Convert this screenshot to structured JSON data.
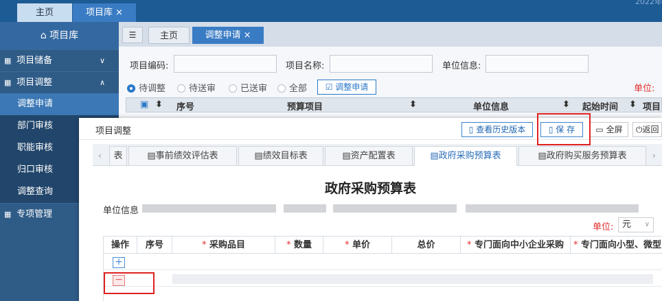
{
  "top_tabs": [
    {
      "label": "主页"
    },
    {
      "label": "项目库",
      "close": "×"
    }
  ],
  "year_fragment": "2022年",
  "sidebar": {
    "title": "项目库",
    "groups": [
      {
        "label": "项目储备",
        "icon": "grid-icon",
        "chevron": "∨"
      },
      {
        "label": "项目调整",
        "icon": "grid-icon",
        "chevron": "∧"
      }
    ],
    "subs": [
      "调整申请",
      "部门审核",
      "职能审核",
      "归口审核",
      "调整查询"
    ],
    "last_group": {
      "label": "专项管理"
    }
  },
  "inner_tabs": {
    "menu": "☰",
    "home": "主页",
    "active": "调整申请",
    "close": "×"
  },
  "filters": {
    "code_label": "项目编码:",
    "name_label": "项目名称:",
    "unit_label": "单位信息:",
    "radios": [
      "待调整",
      "待送审",
      "已送审",
      "全部"
    ],
    "adjust_button": "调整申请",
    "unit_red": "单位:"
  },
  "grid_header": {
    "seq": "序号",
    "budget": "预算项目",
    "unit": "单位信息",
    "start": "起始时间",
    "proj": "项目"
  },
  "modal": {
    "title": "项目调整",
    "history_button": "查看历史版本",
    "save_button": "保 存",
    "fullscreen_button": "全屏",
    "back_button": "返回",
    "tabs": [
      "表",
      "事前绩效评估表",
      "绩效目标表",
      "资产配置表",
      "政府采购预算表",
      "政府购买服务预算表"
    ],
    "sheet_title": "政府采购预算表",
    "unit_info_label": "单位信息",
    "unit_label": "单位:",
    "unit_value": "元",
    "columns": [
      "操作",
      "序号",
      "采购品目",
      "数量",
      "单价",
      "总价",
      "专门面向中小企业采购",
      "专门面向小型、微型"
    ],
    "required_mark": "*",
    "plus": "+",
    "minus": "−"
  },
  "colors": {
    "topbar": "#1d5b94",
    "sidebar": "#2f5b87",
    "accent": "#3a7cc4",
    "red": "#e02020"
  }
}
